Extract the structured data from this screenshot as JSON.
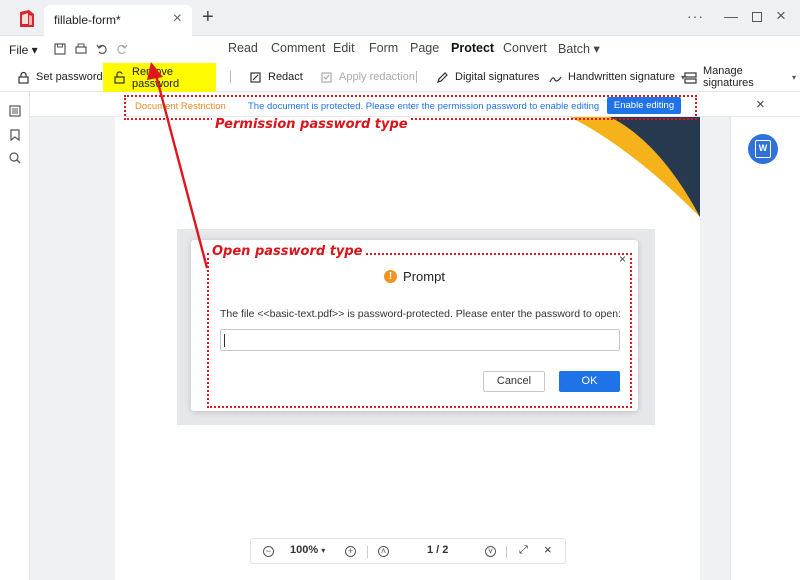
{
  "tab": {
    "title": "fillable-form*"
  },
  "menu": {
    "file_label": "File",
    "items": [
      {
        "label": "Read"
      },
      {
        "label": "Comment"
      },
      {
        "label": "Edit"
      },
      {
        "label": "Form"
      },
      {
        "label": "Page"
      },
      {
        "label": "Protect",
        "active": true
      },
      {
        "label": "Convert"
      },
      {
        "label": "Batch"
      }
    ]
  },
  "toolbar": {
    "set_password": "Set password",
    "remove_password": "Remove password",
    "redact": "Redact",
    "apply_redaction": "Apply redaction",
    "digital_signatures": "Digital signatures",
    "handwritten_signature": "Handwritten signature",
    "manage_signatures": "Manage signatures"
  },
  "restriction": {
    "label": "Document Restriction",
    "message": "The document is protected. Please enter the permission password to enable editing",
    "enable_button": "Enable editing"
  },
  "dialog": {
    "title": "Prompt",
    "message": "The file <<basic-text.pdf>> is password-protected. Please enter the password to open:",
    "input_value": "",
    "cancel": "Cancel",
    "ok": "OK"
  },
  "annotations": {
    "permission": "Permission password type",
    "open": "Open password type"
  },
  "bottom": {
    "zoom": "100%",
    "page_indicator": "1 / 2"
  },
  "colors": {
    "accent": "#1f73e8",
    "restriction_label": "#f08a24",
    "annotation": "#e0161d",
    "highlight": "#fffb00"
  }
}
